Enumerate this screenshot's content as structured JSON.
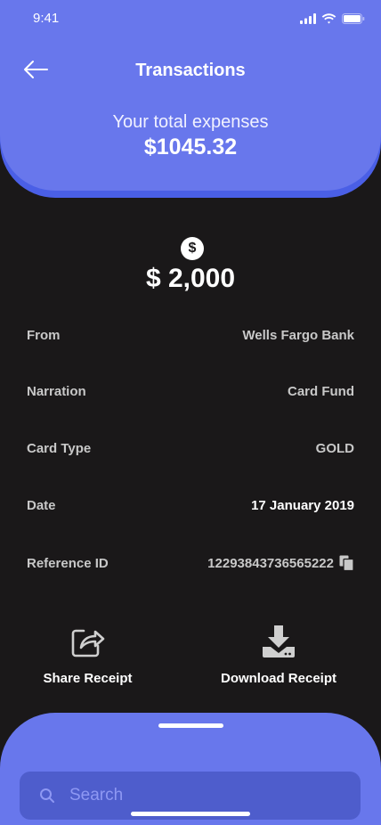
{
  "status_bar": {
    "time": "9:41"
  },
  "header": {
    "title": "Transactions",
    "expenses_label": "Your total expenses",
    "expenses_value": "$1045.32"
  },
  "transaction": {
    "amount": "$ 2,000",
    "coin_symbol": "$",
    "details": [
      {
        "label": "From",
        "value": "Wells Fargo Bank"
      },
      {
        "label": "Narration",
        "value": "Card Fund"
      },
      {
        "label": "Card Type",
        "value": "GOLD"
      },
      {
        "label": "Date",
        "value": "17 January 2019"
      },
      {
        "label": "Reference ID",
        "value": "12293843736565222"
      }
    ]
  },
  "actions": {
    "share_label": "Share Receipt",
    "download_label": "Download Receipt"
  },
  "search": {
    "placeholder": "Search"
  },
  "colors": {
    "primary": "#6877ec",
    "primary_dark": "#4a5fe6",
    "background": "#1a1819",
    "search_bg": "#4e5dcc"
  }
}
